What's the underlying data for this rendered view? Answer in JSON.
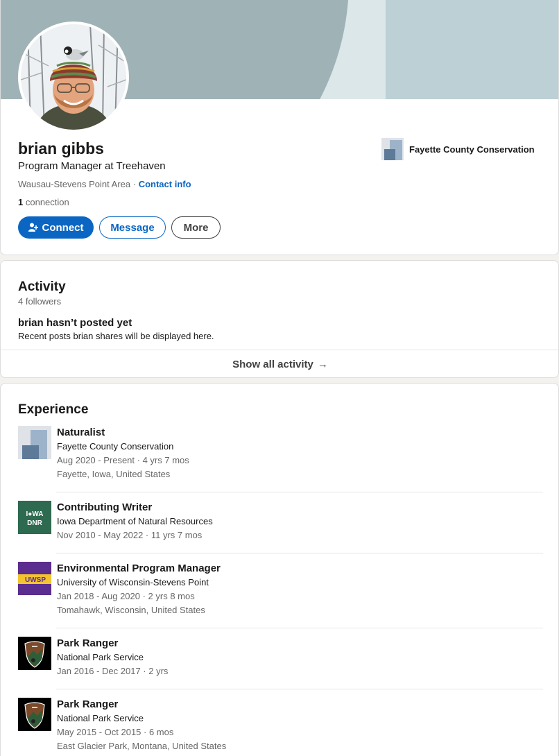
{
  "profile": {
    "name": "brian gibbs",
    "headline": "Program Manager at Treehaven",
    "location": "Wausau-Stevens Point Area",
    "separator": "·",
    "contact_info": "Contact info",
    "connections_count": "1",
    "connections_label": "connection",
    "current_company": "Fayette County Conservation"
  },
  "actions": {
    "connect": "Connect",
    "message": "Message",
    "more": "More"
  },
  "activity": {
    "title": "Activity",
    "followers": "4 followers",
    "empty_title": "brian hasn’t posted yet",
    "empty_sub": "Recent posts brian shares will be displayed here.",
    "show_all": "Show all activity",
    "arrow": "→"
  },
  "experience": {
    "title": "Experience",
    "items": [
      {
        "title": "Naturalist",
        "org": "Fayette County Conservation",
        "dates": "Aug 2020 - Present · 4 yrs 7 mos",
        "location": "Fayette, Iowa, United States",
        "logo": "placeholder-company-logo"
      },
      {
        "title": "Contributing Writer",
        "org": "Iowa Department of Natural Resources",
        "dates": "Nov 2010 - May 2022 · 11 yrs 7 mos",
        "logo": "iowa-dnr-logo",
        "logo_text_1": "I●WA",
        "logo_text_2": "DNR"
      },
      {
        "title": "Environmental Program Manager",
        "org": "University of Wisconsin-Stevens Point",
        "dates": "Jan 2018 - Aug 2020 · 2 yrs 8 mos",
        "location": "Tomahawk, Wisconsin, United States",
        "logo": "uwsp-logo",
        "logo_text": "UWSP"
      },
      {
        "title": "Park Ranger",
        "org": "National Park Service",
        "dates": "Jan 2016 - Dec 2017 · 2 yrs",
        "logo": "nps-arrowhead-logo"
      },
      {
        "title": "Park Ranger",
        "org": "National Park Service",
        "dates": "May 2015 - Oct 2015 · 6 mos",
        "location": "East Glacier Park, Montana, United States",
        "logo": "nps-arrowhead-logo"
      }
    ]
  },
  "colors": {
    "brand_blue": "#0a66c2",
    "banner_dark": "#9fb3b7",
    "banner_light": "#dce7e9",
    "banner_right": "#bcd0d5",
    "iowa_green": "#2d6a4f",
    "uwsp_purple": "#5b2d8e",
    "uwsp_gold": "#f4c430"
  }
}
